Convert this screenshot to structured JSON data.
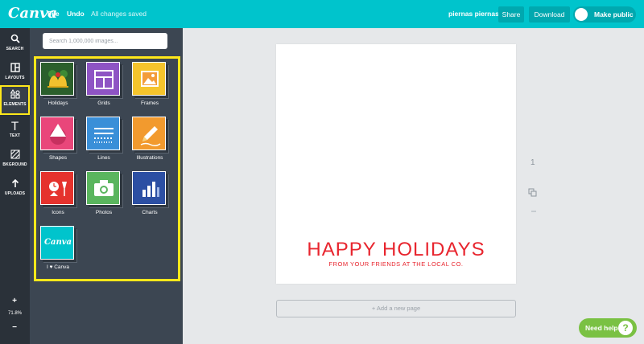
{
  "topbar": {
    "logo": "Canva",
    "file": "File",
    "undo": "Undo",
    "saved_status": "All changes saved",
    "user": "piernas piernas",
    "share": "Share",
    "download": "Download",
    "make_public": "Make public"
  },
  "rail": {
    "search": "SEARCH",
    "layouts": "LAYOUTS",
    "elements": "ELEMENTS",
    "text": "TEXT",
    "background": "BKGROUND",
    "uploads": "UPLOADS",
    "zoom_in": "+",
    "zoom": "71.8%",
    "zoom_out": "−"
  },
  "panel": {
    "search_placeholder": "Search 1,000,000 images...",
    "tiles": [
      "Holidays",
      "Grids",
      "Frames",
      "Shapes",
      "Lines",
      "Illustrations",
      "Icons",
      "Photos",
      "Charts",
      "I ♥ Canva"
    ],
    "canva_tile_text": "Canva"
  },
  "canvas": {
    "headline": "HAPPY HOLIDAYS",
    "subline": "FROM YOUR FRIENDS AT THE LOCAL CO.",
    "page_number": "1",
    "add_page": "+ Add a new page"
  },
  "help": {
    "label": "Need help",
    "q": "?"
  },
  "colors": {
    "topbar": "#00c4cc",
    "rail": "#2a3139",
    "panel": "#3c4652",
    "highlight": "#ffe81a",
    "headline": "#e8252e",
    "help": "#7ac143"
  }
}
